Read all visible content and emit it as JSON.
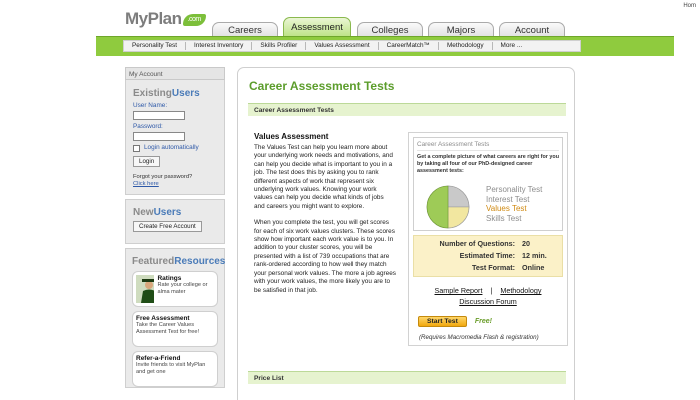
{
  "header": {
    "logo_text": "MyPlan",
    "logo_badge": ".com",
    "home_link": "Hom",
    "tabs": [
      {
        "label": "Careers",
        "active": false
      },
      {
        "label": "Assessment",
        "active": true
      },
      {
        "label": "Colleges",
        "active": false
      },
      {
        "label": "Majors",
        "active": false
      },
      {
        "label": "Account",
        "active": false
      }
    ],
    "subnav": [
      "Personality Test",
      "Interest Inventory",
      "Skills Profiler",
      "Values Assessment",
      "CareerMatch™",
      "Methodology",
      "More ..."
    ]
  },
  "sidebar": {
    "my_account": "My Account",
    "existing": {
      "title_a": "Existing",
      "title_b": "Users",
      "username_label": "User Name:",
      "password_label": "Password:",
      "login_auto": "Login automatically",
      "login_button": "Login",
      "forgot_text": "Forgot your password?",
      "forgot_link": "Click here"
    },
    "new_users": {
      "title_a": "New",
      "title_b": "Users",
      "button": "Create Free Account"
    },
    "featured": {
      "title_a": "Featured",
      "title_b": "Resources",
      "items": [
        {
          "title": "Ratings",
          "text": "Rate your college or alma mater"
        },
        {
          "title": "Free Assessment",
          "text": "Take the Career Values Assessment Test for free!"
        },
        {
          "title": "Refer-a-Friend",
          "text": "Invite friends to visit MyPlan and get one"
        }
      ]
    }
  },
  "main": {
    "title": "Career Assessment Tests",
    "section1": "Career Assessment Tests",
    "section2": "Price List",
    "desc_title": "Values Assessment",
    "desc_p1": "The Values Test can help you learn more about your underlying work needs and motivations, and can help you decide what is important to you in a job. The test does this by asking you to rank different aspects of work that represent six underlying work values. Knowing your work values can help you decide what kinds of jobs and careers you might want to explore.",
    "desc_p2": "When you complete the test, you will get scores for each of six work values clusters. These scores show how important each work value is to you. In addition to your cluster scores, you will be presented with a list of 739 occupations that are rank-ordered according to how well they match your personal work values. The more a job agrees with your work values, the more likely you are to be satisfied in that job.",
    "panel": {
      "header": "Career Assessment Tests",
      "blurb": "Get a complete picture of what careers are right for you by taking all four of our PhD-designed career assessment tests:",
      "tests": [
        {
          "name": "Personality Test",
          "highlight": false
        },
        {
          "name": "Interest Test",
          "highlight": false
        },
        {
          "name": "Values Test",
          "highlight": true
        },
        {
          "name": "Skills Test",
          "highlight": false
        }
      ],
      "pie_colors": [
        "#9ecb57",
        "#f2e7a0",
        "#c9c9c9",
        "#dcdcdc"
      ],
      "stats": [
        {
          "label": "Number of Questions:",
          "value": "20"
        },
        {
          "label": "Estimated Time:",
          "value": "12 min."
        },
        {
          "label": "Test Format:",
          "value": "Online"
        }
      ],
      "sample_report": "Sample Report",
      "separator": "|",
      "methodology": "Methodology",
      "discussion": "Discussion Forum",
      "start_button": "Start Test",
      "free_label": "Free!",
      "requires": "(Requires Macromedia Flash & registration)"
    }
  }
}
